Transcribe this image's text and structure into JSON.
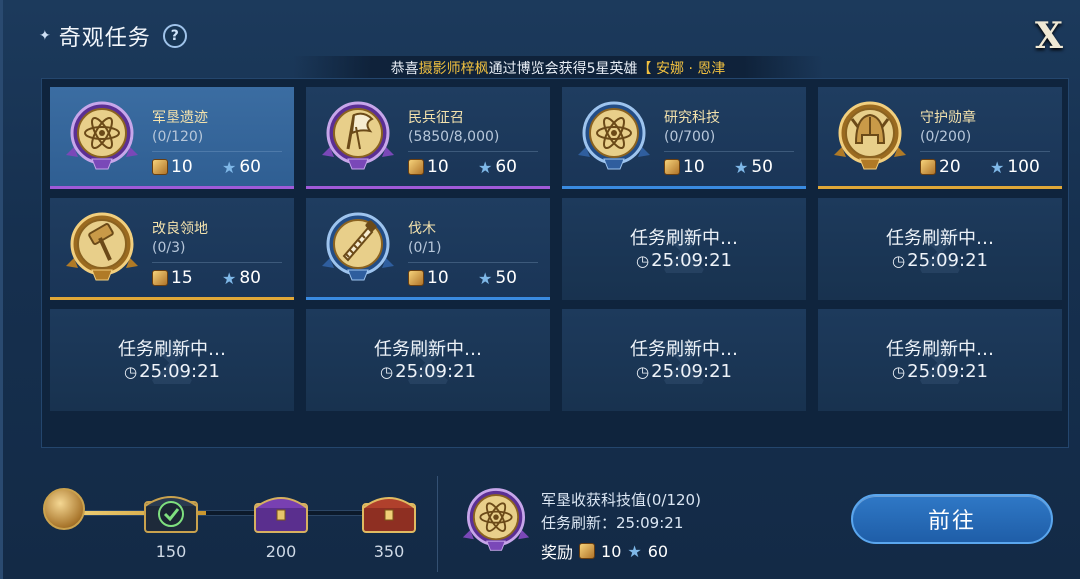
{
  "header": {
    "title": "奇观任务",
    "help_symbol": "?",
    "close_symbol": "X"
  },
  "ticker": {
    "prefix": "恭喜",
    "player": "摄影师梓枫",
    "middle": "通过博览会获得5星英雄",
    "hero": "【 安娜 · 恩津"
  },
  "tasks": [
    {
      "name": "军垦遗迹",
      "progress": "(0/120)",
      "coins": "10",
      "stars": "60",
      "color": "purple",
      "icon": "atom-icon"
    },
    {
      "name": "民兵征召",
      "progress": "(5850/8,000)",
      "coins": "10",
      "stars": "60",
      "color": "purple",
      "icon": "flag-icon"
    },
    {
      "name": "研究科技",
      "progress": "(0/700)",
      "coins": "10",
      "stars": "50",
      "color": "blue",
      "icon": "atom-icon"
    },
    {
      "name": "守护勋章",
      "progress": "(0/200)",
      "coins": "20",
      "stars": "100",
      "color": "gold",
      "icon": "helmet-icon"
    },
    {
      "name": "改良领地",
      "progress": "(0/3)",
      "coins": "15",
      "stars": "80",
      "color": "gold",
      "icon": "hammer-icon"
    },
    {
      "name": "伐木",
      "progress": "(0/1)",
      "coins": "10",
      "stars": "50",
      "color": "blue",
      "icon": "saw-icon"
    }
  ],
  "refresh": {
    "text": "任务刷新中…",
    "timer": "25:09:21"
  },
  "milestones": {
    "labels": [
      "150",
      "200",
      "350"
    ],
    "progress_fraction": 0.42
  },
  "current_task": {
    "title": "军垦收获科技值(0/120)",
    "refresh_line": "任务刷新：25:09:21",
    "reward_label": "奖励",
    "coins": "10",
    "stars": "60"
  },
  "go_button": "前往",
  "colors": {
    "purple": "#a05ad8",
    "blue": "#3a8be0",
    "gold": "#e0a838",
    "ticker_highlight": "#f0c040"
  }
}
